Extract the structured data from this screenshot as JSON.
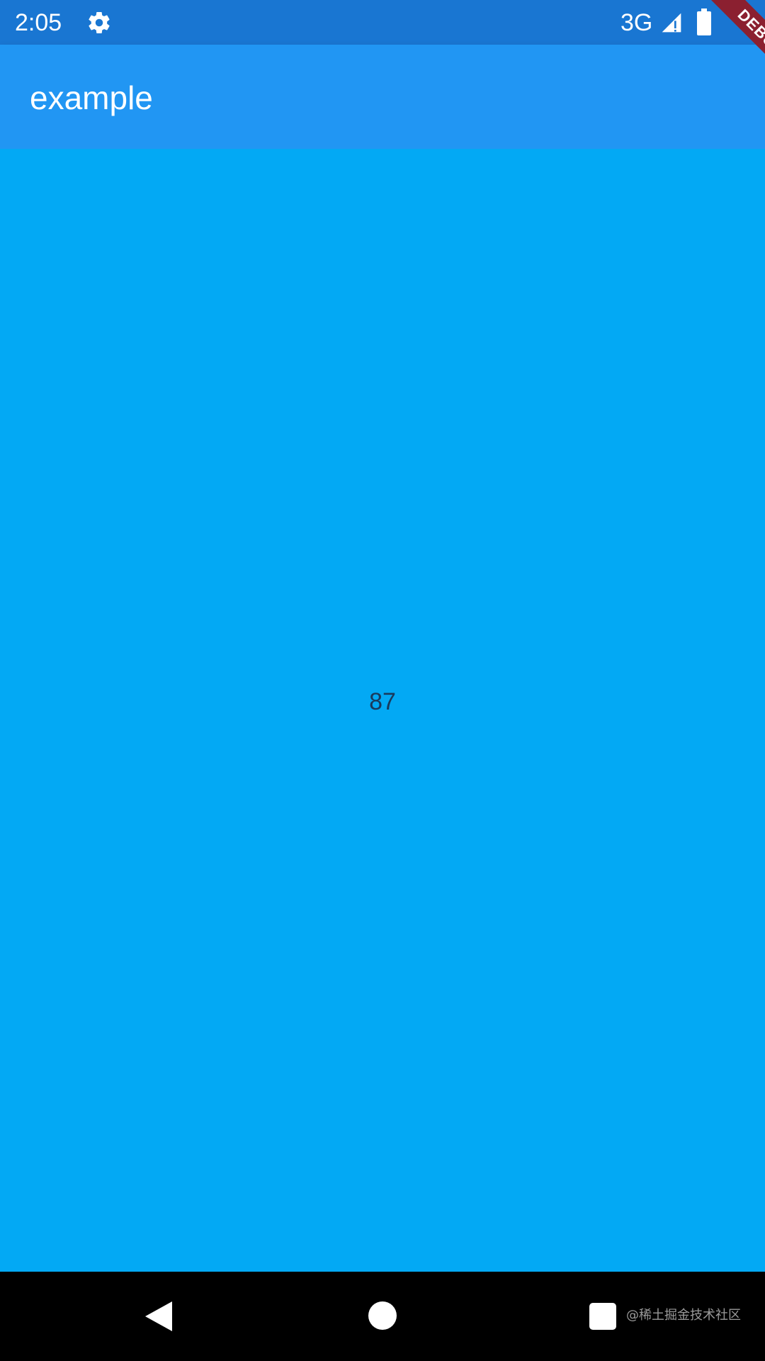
{
  "status_bar": {
    "time": "2:05",
    "settings_icon": "gear-icon",
    "network": "3G",
    "signal_icon": "signal-icon",
    "battery_icon": "battery-icon"
  },
  "app_bar": {
    "title": "example"
  },
  "debug_banner": {
    "label": "DEBUG"
  },
  "content": {
    "counter": "87"
  },
  "nav_bar": {
    "back_icon": "back-triangle-icon",
    "home_icon": "home-circle-icon",
    "recents_icon": "recents-square-icon"
  },
  "watermark": "@稀土掘金技术社区",
  "colors": {
    "status_bar": "#1976d2",
    "app_bar": "#2196f3",
    "content_background": "#03a9f4",
    "debug_ribbon": "#8b2030",
    "nav_bar": "#000000"
  }
}
